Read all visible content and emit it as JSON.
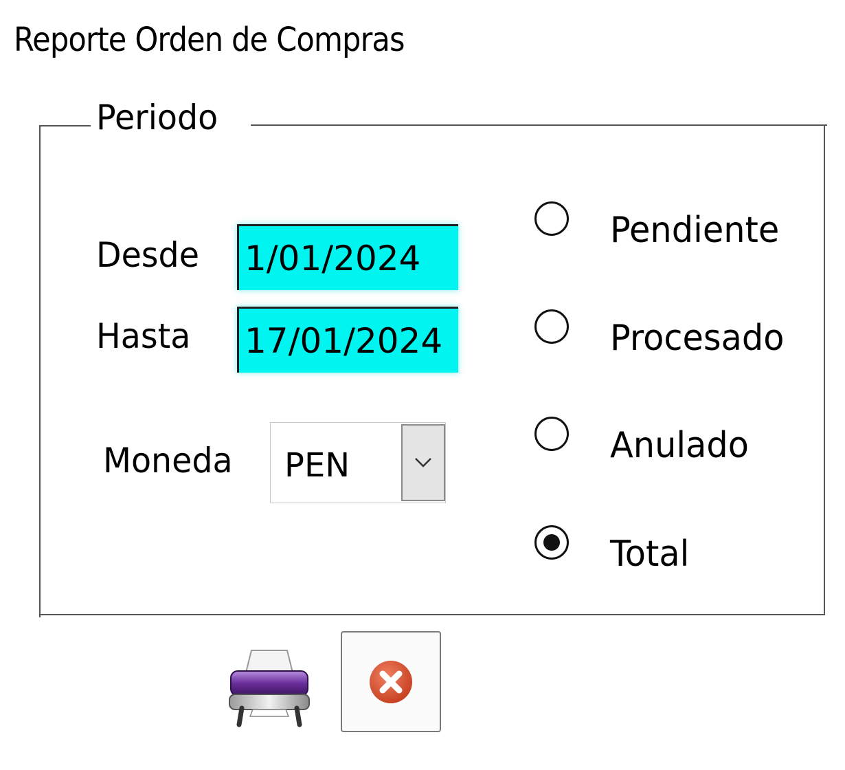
{
  "window": {
    "title": "Reporte Orden de Compras"
  },
  "periodo": {
    "legend": "Periodo",
    "desde_label": "Desde",
    "desde_value": "1/01/2024",
    "hasta_label": "Hasta",
    "hasta_value": "17/01/2024"
  },
  "moneda": {
    "label": "Moneda",
    "selected": "PEN"
  },
  "estado": {
    "options": [
      {
        "label": "Pendiente",
        "checked": false
      },
      {
        "label": "Procesado",
        "checked": false
      },
      {
        "label": "Anulado",
        "checked": false
      },
      {
        "label": "Total",
        "checked": true
      }
    ]
  },
  "actions": {
    "print_icon": "printer-icon",
    "close_icon": "close-circle-icon"
  },
  "colors": {
    "input_bg": "#00f5f0",
    "close_red": "#d9502f",
    "printer_purple": "#6a2d9a"
  }
}
